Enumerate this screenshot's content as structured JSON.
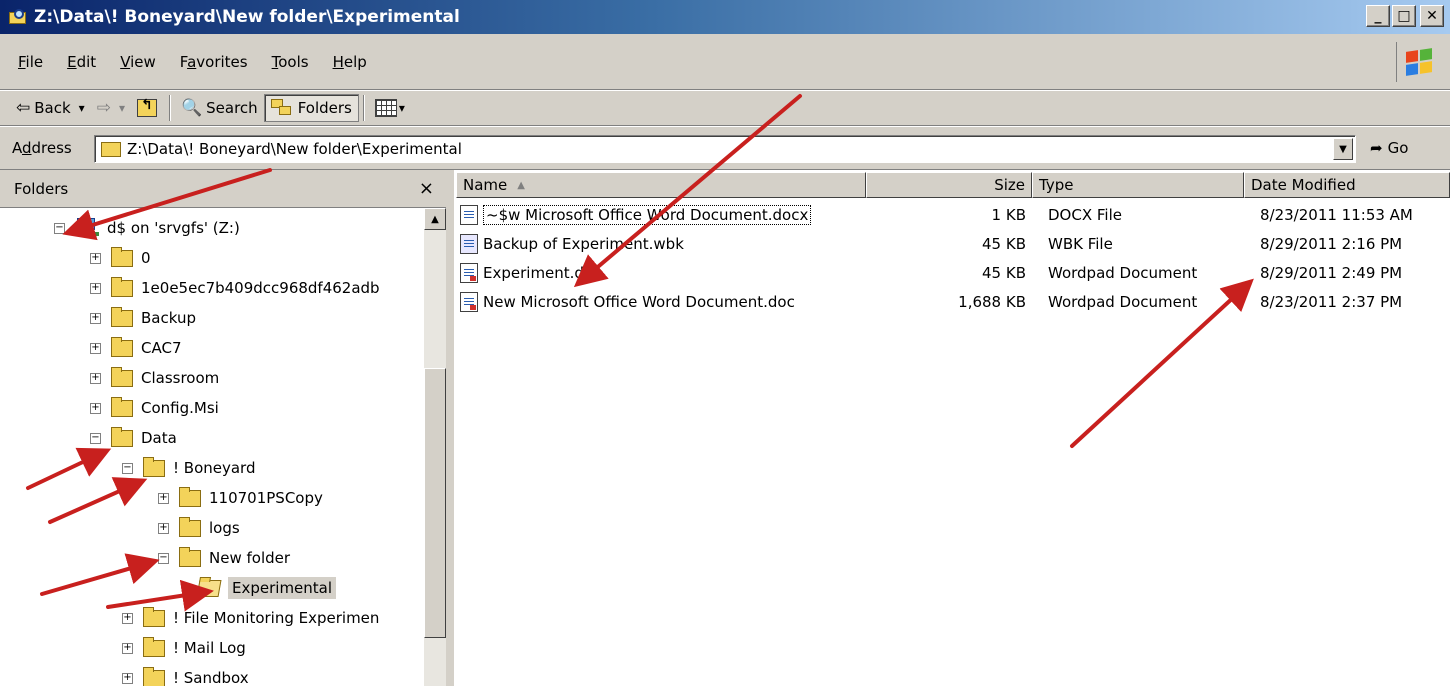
{
  "window": {
    "title": "Z:\\Data\\! Boneyard\\New folder\\Experimental",
    "minimize_glyph": "_",
    "maximize_glyph": "□",
    "close_glyph": "✕"
  },
  "menu": {
    "items": [
      {
        "pre": "",
        "key": "F",
        "post": "ile"
      },
      {
        "pre": "",
        "key": "E",
        "post": "dit"
      },
      {
        "pre": "",
        "key": "V",
        "post": "iew"
      },
      {
        "pre": "F",
        "key": "a",
        "post": "vorites"
      },
      {
        "pre": "",
        "key": "T",
        "post": "ools"
      },
      {
        "pre": "",
        "key": "H",
        "post": "elp"
      }
    ]
  },
  "toolbar": {
    "back_label": "Back",
    "search_label": "Search",
    "folders_label": "Folders",
    "back_glyph": "⇦",
    "forward_glyph": "⇨",
    "dropdown_glyph": "▾",
    "search_glyph": "🔍"
  },
  "address": {
    "label_pre": "A",
    "label_key": "d",
    "label_post": "dress",
    "value": "Z:\\Data\\! Boneyard\\New folder\\Experimental",
    "go_label": "Go",
    "go_glyph": "➦",
    "dropdown_glyph": "▼"
  },
  "folders_pane": {
    "title": "Folders",
    "close_glyph": "×",
    "scroll_up_glyph": "▲",
    "tree": [
      {
        "label": "d$ on 'srvgfs' (Z:)",
        "expander": "−",
        "icon": "drive-icon",
        "level": 0
      },
      {
        "label": "0",
        "expander": "+",
        "icon": "folder-icon",
        "level": 1
      },
      {
        "label": "1e0e5ec7b409dcc968df462adb",
        "expander": "+",
        "icon": "folder-icon",
        "level": 1
      },
      {
        "label": "Backup",
        "expander": "+",
        "icon": "folder-icon",
        "level": 1
      },
      {
        "label": "CAC7",
        "expander": "+",
        "icon": "folder-icon",
        "level": 1
      },
      {
        "label": "Classroom",
        "expander": "+",
        "icon": "folder-icon",
        "level": 1
      },
      {
        "label": "Config.Msi",
        "expander": "+",
        "icon": "folder-icon",
        "level": 1
      },
      {
        "label": "Data",
        "expander": "−",
        "icon": "folder-icon",
        "level": 1
      },
      {
        "label": "! Boneyard",
        "expander": "−",
        "icon": "folder-icon",
        "level": 2
      },
      {
        "label": "110701PSCopy",
        "expander": "+",
        "icon": "folder-icon",
        "level": 3
      },
      {
        "label": "logs",
        "expander": "+",
        "icon": "folder-icon",
        "level": 3
      },
      {
        "label": "New folder",
        "expander": "−",
        "icon": "folder-icon",
        "level": 3
      },
      {
        "label": "Experimental",
        "expander": "",
        "icon": "open-folder-icon",
        "level": 4,
        "selected": true
      },
      {
        "label": "! File Monitoring Experimen",
        "expander": "+",
        "icon": "folder-icon",
        "level": 2
      },
      {
        "label": "! Mail Log",
        "expander": "+",
        "icon": "folder-icon",
        "level": 2
      },
      {
        "label": "! Sandbox",
        "expander": "+",
        "icon": "folder-icon",
        "level": 2
      }
    ]
  },
  "file_list": {
    "columns": {
      "name": "Name",
      "size": "Size",
      "type": "Type",
      "date": "Date Modified"
    },
    "sort_glyph": "▲",
    "files": [
      {
        "name": "~$w Microsoft Office Word Document.docx",
        "size": "1 KB",
        "type": "DOCX File",
        "date": "8/23/2011 11:53 AM",
        "icon": "docx-file-icon"
      },
      {
        "name": "Backup of Experiment.wbk",
        "size": "45 KB",
        "type": "WBK File",
        "date": "8/29/2011 2:16 PM",
        "icon": "wbk-file-icon"
      },
      {
        "name": "Experiment.doc",
        "size": "45 KB",
        "type": "Wordpad Document",
        "date": "8/29/2011 2:49 PM",
        "icon": "wordpad-doc-icon"
      },
      {
        "name": "New Microsoft Office Word Document.doc",
        "size": "1,688 KB",
        "type": "Wordpad Document",
        "date": "8/23/2011 2:37 PM",
        "icon": "wordpad-doc-icon"
      }
    ]
  },
  "annotation_color": "#c8201e"
}
